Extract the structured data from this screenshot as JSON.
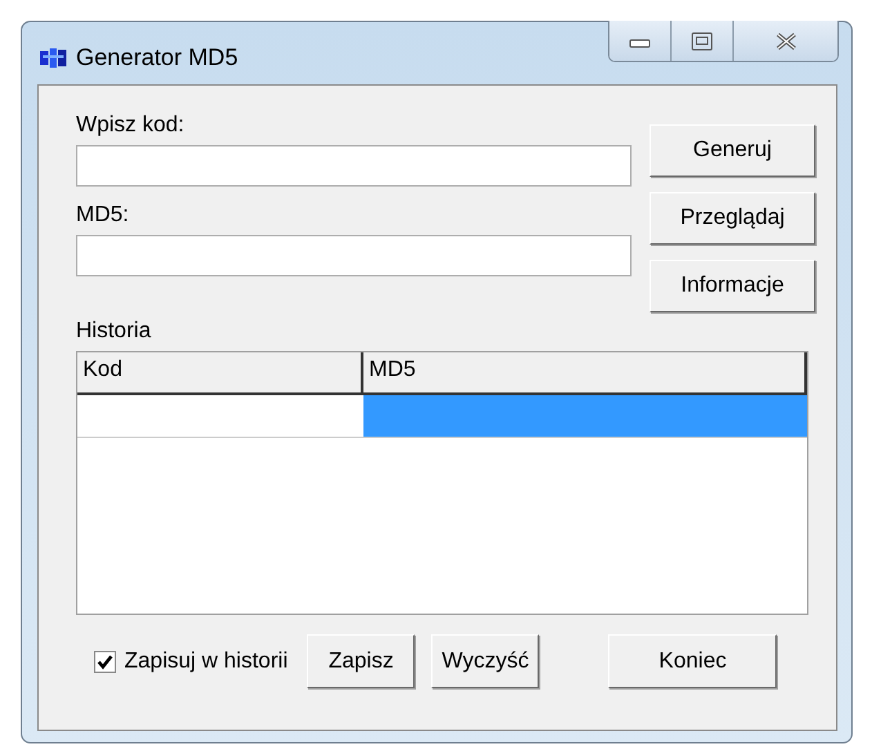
{
  "window": {
    "title": "Generator MD5"
  },
  "code_field": {
    "label": "Wpisz kod:"
  },
  "md5_field": {
    "label": "MD5:"
  },
  "side_buttons": [
    "Generuj",
    "Przeglądaj",
    "Informacje"
  ],
  "history": {
    "label": "Historia",
    "columns": [
      "Kod",
      "MD5"
    ],
    "rows": [
      {
        "cells": [
          {
            "selected": false
          },
          {
            "selected": true
          }
        ]
      }
    ]
  },
  "save_to_history": {
    "label": "Zapisuj w historii",
    "checked": true
  },
  "bottom_buttons": [
    "Zapisz",
    "Wyczyść"
  ],
  "close_button": "Koniec"
}
